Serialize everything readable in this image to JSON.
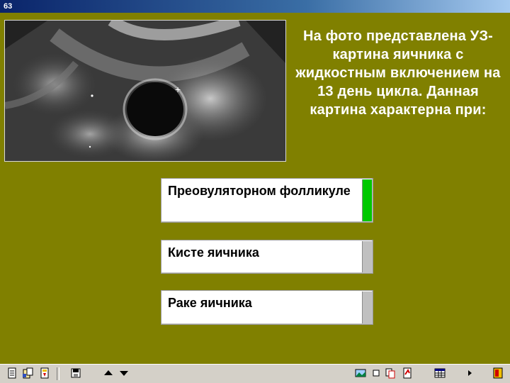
{
  "window": {
    "title": "63"
  },
  "question": {
    "text": "На фото представлена УЗ-картина яичника с жидкостным включением на 13 день цикла. Данная картина характерна при:"
  },
  "answers": [
    {
      "label": "Преовуляторном фолликуле",
      "state": "correct",
      "indicator_color": "#00c800"
    },
    {
      "label": "Кисте яичника",
      "state": "neutral",
      "indicator_color": "#c0c0c0"
    },
    {
      "label": "Раке яичника",
      "state": "neutral",
      "indicator_color": "#c0c0c0"
    }
  ],
  "colors": {
    "background": "#808000",
    "question_text": "#ffffff",
    "correct": "#00c800"
  },
  "toolbar": {
    "left_icons": [
      "document-icon",
      "clipboard-icon",
      "bookmark-icon",
      "save-icon",
      "arrow-up-icon",
      "arrow-down-icon"
    ],
    "right_icons": [
      "picture-icon",
      "square-icon",
      "copy-icon",
      "print-icon",
      "grid-icon",
      "play-icon",
      "exit-icon"
    ]
  }
}
